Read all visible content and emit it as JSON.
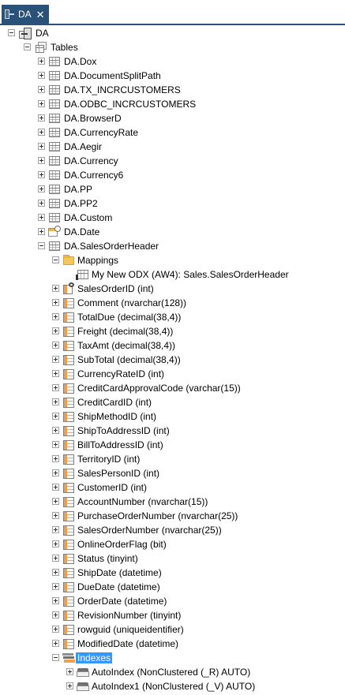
{
  "tab": {
    "label": "DA",
    "close_glyph": "✕"
  },
  "tree": {
    "root": "DA",
    "tables_folder": "Tables",
    "tables": [
      {
        "label": "DA.Dox",
        "icon": "table-icon"
      },
      {
        "label": "DA.DocumentSplitPath",
        "icon": "table-icon"
      },
      {
        "label": "DA.TX_INCRCUSTOMERS",
        "icon": "table-icon"
      },
      {
        "label": "DA.ODBC_INCRCUSTOMERS",
        "icon": "table-icon"
      },
      {
        "label": "DA.BrowserD",
        "icon": "table-icon"
      },
      {
        "label": "DA.CurrencyRate",
        "icon": "table-icon"
      },
      {
        "label": "DA.Aegir",
        "icon": "table-icon"
      },
      {
        "label": "DA.Currency",
        "icon": "table-icon"
      },
      {
        "label": "DA.Currency6",
        "icon": "table-icon"
      },
      {
        "label": "DA.PP",
        "icon": "table-icon"
      },
      {
        "label": "DA.PP2",
        "icon": "table-icon"
      },
      {
        "label": "DA.Custom",
        "icon": "table-icon"
      },
      {
        "label": "DA.Date",
        "icon": "date-table-icon"
      }
    ],
    "selected_table": "DA.SalesOrderHeader",
    "mappings_folder": "Mappings",
    "mapping_item": "My New ODX (AW4): Sales.SalesOrderHeader",
    "columns": [
      "SalesOrderID (int)",
      "Comment (nvarchar(128))",
      "TotalDue (decimal(38,4))",
      "Freight (decimal(38,4))",
      "TaxAmt (decimal(38,4))",
      "SubTotal (decimal(38,4))",
      "CurrencyRateID (int)",
      "CreditCardApprovalCode (varchar(15))",
      "CreditCardID (int)",
      "ShipMethodID (int)",
      "ShipToAddressID (int)",
      "BillToAddressID (int)",
      "TerritoryID (int)",
      "SalesPersonID (int)",
      "CustomerID (int)",
      "AccountNumber (nvarchar(15))",
      "PurchaseOrderNumber (nvarchar(25))",
      "SalesOrderNumber (nvarchar(25))",
      "OnlineOrderFlag (bit)",
      "Status (tinyint)",
      "ShipDate (datetime)",
      "DueDate (datetime)",
      "OrderDate (datetime)",
      "RevisionNumber (tinyint)",
      "rowguid (uniqueidentifier)",
      "ModifiedDate (datetime)"
    ],
    "indexes_folder": "Indexes",
    "indexes": [
      "AutoIndex (NonClustered (_R) AUTO)",
      "AutoIndex1 (NonClustered (_V) AUTO)"
    ]
  },
  "colors": {
    "tab_bg": "#2a5279",
    "selection_bg": "#3399ff"
  }
}
